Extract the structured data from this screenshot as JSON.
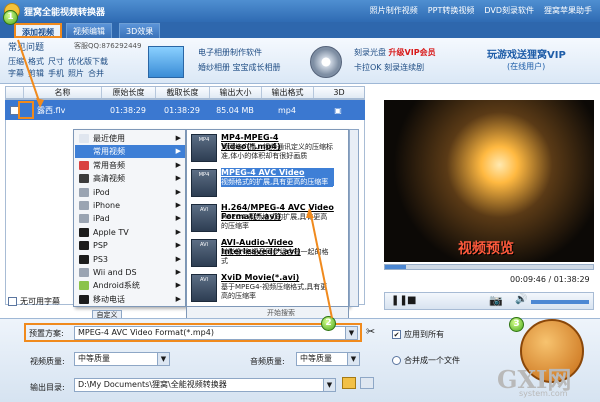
{
  "app": {
    "title": "狸窝全能视频转换器",
    "links": [
      "照片制作视频",
      "PPT转换视频",
      "DVD刻录软件",
      "狸窝苹果助手"
    ]
  },
  "tabs": [
    {
      "label": "添加视频"
    },
    {
      "label": "视频编辑"
    },
    {
      "label": "3D效果"
    }
  ],
  "toolbar": {
    "faq_label": "常见问题",
    "service_label": "客服QQ:876292449",
    "faq_row1": [
      "压缩",
      "格式",
      "尺寸",
      "优化版下载"
    ],
    "faq_row2": [
      "字幕",
      "剪辑",
      "手机",
      "照片",
      "合并"
    ],
    "promo1": {
      "line1": "电子相册制作软件",
      "line2": "婚纱相册",
      "line3": "宝宝成长相册"
    },
    "promo2": {
      "line1": "刻录光盘",
      "line1_red": "升级VIP会员",
      "line2": "卡拉OK",
      "line3": "刻录连续剧"
    },
    "vip_title": "玩游戏送狸窝VIP",
    "vip_sub": "(在线用户)"
  },
  "table": {
    "headers": [
      "名称",
      "原始长度",
      "截取长度",
      "输出大小",
      "输出格式",
      "3D"
    ],
    "row": {
      "name": "露西.flv",
      "orig_len": "01:38:29",
      "cut_len": "01:38:29",
      "out_size": "85.04 MB",
      "out_fmt": "mp4"
    },
    "subtitle_label": "无可用字幕"
  },
  "context_menu": {
    "items": [
      {
        "label": "最近使用",
        "color": "#e0e6ef"
      },
      {
        "label": "常用视频",
        "color": "#3e7fd6",
        "selected": true
      },
      {
        "label": "常用音频",
        "color": "#d94141"
      },
      {
        "label": "高清视频",
        "color": "#3c3c3c"
      },
      {
        "label": "iPod",
        "color": "#9aa4b2"
      },
      {
        "label": "iPhone",
        "color": "#9aa4b2"
      },
      {
        "label": "iPad",
        "color": "#9aa4b2"
      },
      {
        "label": "Apple TV",
        "color": "#1c1c1c"
      },
      {
        "label": "PSP",
        "color": "#1c1c1c"
      },
      {
        "label": "PS3",
        "color": "#1c1c1c"
      },
      {
        "label": "Wii and DS",
        "color": "#9aa4b2"
      },
      {
        "label": "Android系统",
        "color": "#8bc34a"
      },
      {
        "label": "移动电话",
        "color": "#1c1c1c"
      }
    ],
    "custom_button": "自定义"
  },
  "formats": [
    {
      "badge": "MP4",
      "name": "MP4-MPEG-4 Video(*.mp4)",
      "desc": "为网络广播、视频通讯定义的压缩标准,体小的体积却有很好画质",
      "selected": false
    },
    {
      "badge": "MP4",
      "name": "MPEG-4 AVC Video Format(*.mp4)",
      "desc": "视频格式的扩展,具有更高的压缩率",
      "selected": true
    },
    {
      "badge": "AVI",
      "name": "H.264/MPEG-4 AVC Video Format(*.avi)",
      "desc": "MPEG4-视频格式的扩展,具有更高的压缩率",
      "selected": false
    },
    {
      "badge": "AVI",
      "name": "AVI-Audio-Video Interleaved(*.avi)",
      "desc": "对影像-和语音同步组合在一起的格式",
      "selected": false
    },
    {
      "badge": "AVI",
      "name": "XviD Movie(*.avi)",
      "desc": "基于MPEG4-视频压缩格式,具有更高的压缩率",
      "selected": false
    }
  ],
  "submenu_search": "开始搜索",
  "preview": {
    "caption": "视频预览",
    "time": "00:09:46 / 01:38:29",
    "progress": 0.1
  },
  "bottom": {
    "preset_label": "预置方案:",
    "preset_value": "MPEG-4 AVC Video Format(*.mp4)",
    "apply_all": "应用到所有",
    "video_quality_label": "视频质量:",
    "video_quality": "中等质量",
    "audio_quality_label": "音频质量:",
    "audio_quality": "中等质量",
    "merge_label": "合并成一个文件",
    "output_label": "输出目录:",
    "output_path": "D:\\My Documents\\狸窝\\全能视频转换器",
    "markers": [
      "1",
      "2",
      "3"
    ]
  },
  "watermark": {
    "text": "GXI网",
    "sub": "system.com"
  }
}
